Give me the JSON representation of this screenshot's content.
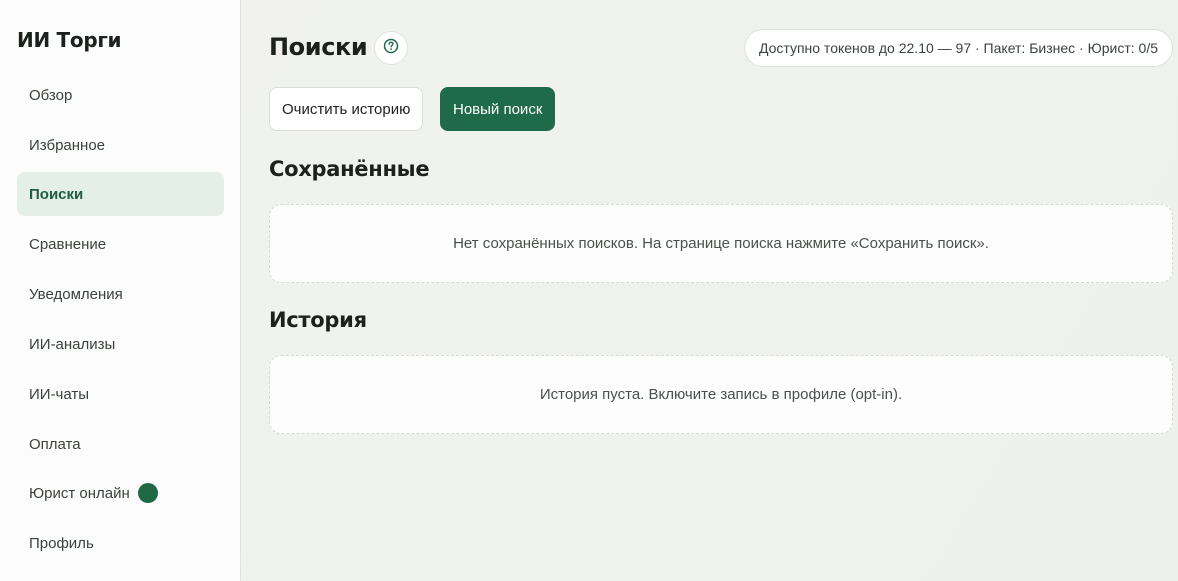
{
  "app": {
    "brand": "ИИ Торги"
  },
  "sidebar": {
    "items": [
      {
        "label": "Обзор"
      },
      {
        "label": "Избранное"
      },
      {
        "label": "Поиски"
      },
      {
        "label": "Сравнение"
      },
      {
        "label": "Уведомления"
      },
      {
        "label": "ИИ-анализы"
      },
      {
        "label": "ИИ-чаты"
      },
      {
        "label": "Оплата"
      },
      {
        "label": "Юрист онлайн"
      },
      {
        "label": "Профиль"
      }
    ],
    "active_item": "Поиски",
    "online_dot_color": "#1f6a45"
  },
  "header": {
    "title": "Поиски",
    "help_icon": "question-circle-icon",
    "tokens_info": "Доступно токенов до 22.10 — 97 · Пакет: Бизнес · Юрист: 0/5"
  },
  "actions": {
    "clear_history": "Очистить историю",
    "new_search": "Новый поиск"
  },
  "saved": {
    "title": "Сохранённые",
    "empty_text": "Нет сохранённых поисков. На странице поиска нажмите «Сохранить поиск»."
  },
  "history": {
    "title": "История",
    "empty_text": "История пуста. Включите запись в профиле (opt-in)."
  },
  "colors": {
    "accent": "#1f6a48",
    "active_bg": "#e3efe7"
  }
}
